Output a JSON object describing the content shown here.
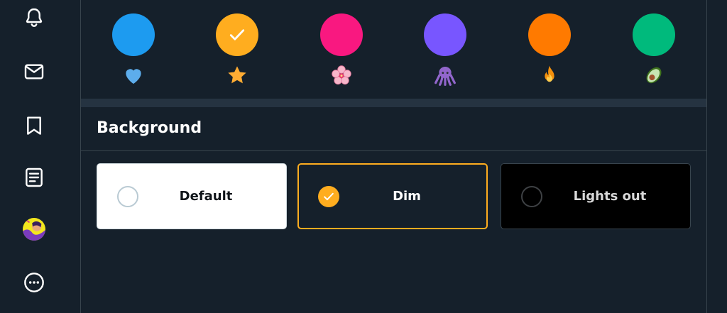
{
  "sidebar": {
    "items": [
      {
        "name": "notifications",
        "icon": "bell-icon"
      },
      {
        "name": "messages",
        "icon": "mail-icon"
      },
      {
        "name": "bookmarks",
        "icon": "bookmark-icon"
      },
      {
        "name": "lists",
        "icon": "list-icon"
      },
      {
        "name": "profile",
        "icon": "avatar"
      },
      {
        "name": "more",
        "icon": "more-icon"
      }
    ]
  },
  "colors": [
    {
      "name": "blue",
      "hex": "#1d9bf0",
      "emoji": "blue-heart-icon",
      "selected": false
    },
    {
      "name": "yellow",
      "hex": "#ffad1f",
      "emoji": "star-icon",
      "selected": true
    },
    {
      "name": "pink",
      "hex": "#f91880",
      "emoji": "cherry-blossom-icon",
      "selected": false
    },
    {
      "name": "purple",
      "hex": "#7856ff",
      "emoji": "octopus-icon",
      "selected": false
    },
    {
      "name": "orange",
      "hex": "#ff7a00",
      "emoji": "fire-icon",
      "selected": false
    },
    {
      "name": "green",
      "hex": "#00ba7c",
      "emoji": "avocado-icon",
      "selected": false
    }
  ],
  "background": {
    "title": "Background",
    "options": [
      {
        "label": "Default",
        "selected": false,
        "bg": "#ffffff",
        "text": "#0f1419"
      },
      {
        "label": "Dim",
        "selected": true,
        "bg": "#15202b",
        "text": "#ffffff"
      },
      {
        "label": "Lights out",
        "selected": false,
        "bg": "#000000",
        "text": "#d9d9d9"
      }
    ]
  },
  "theme": {
    "accent": "#ffad1f",
    "dim_bg": "#15202b",
    "border": "#38444d"
  }
}
